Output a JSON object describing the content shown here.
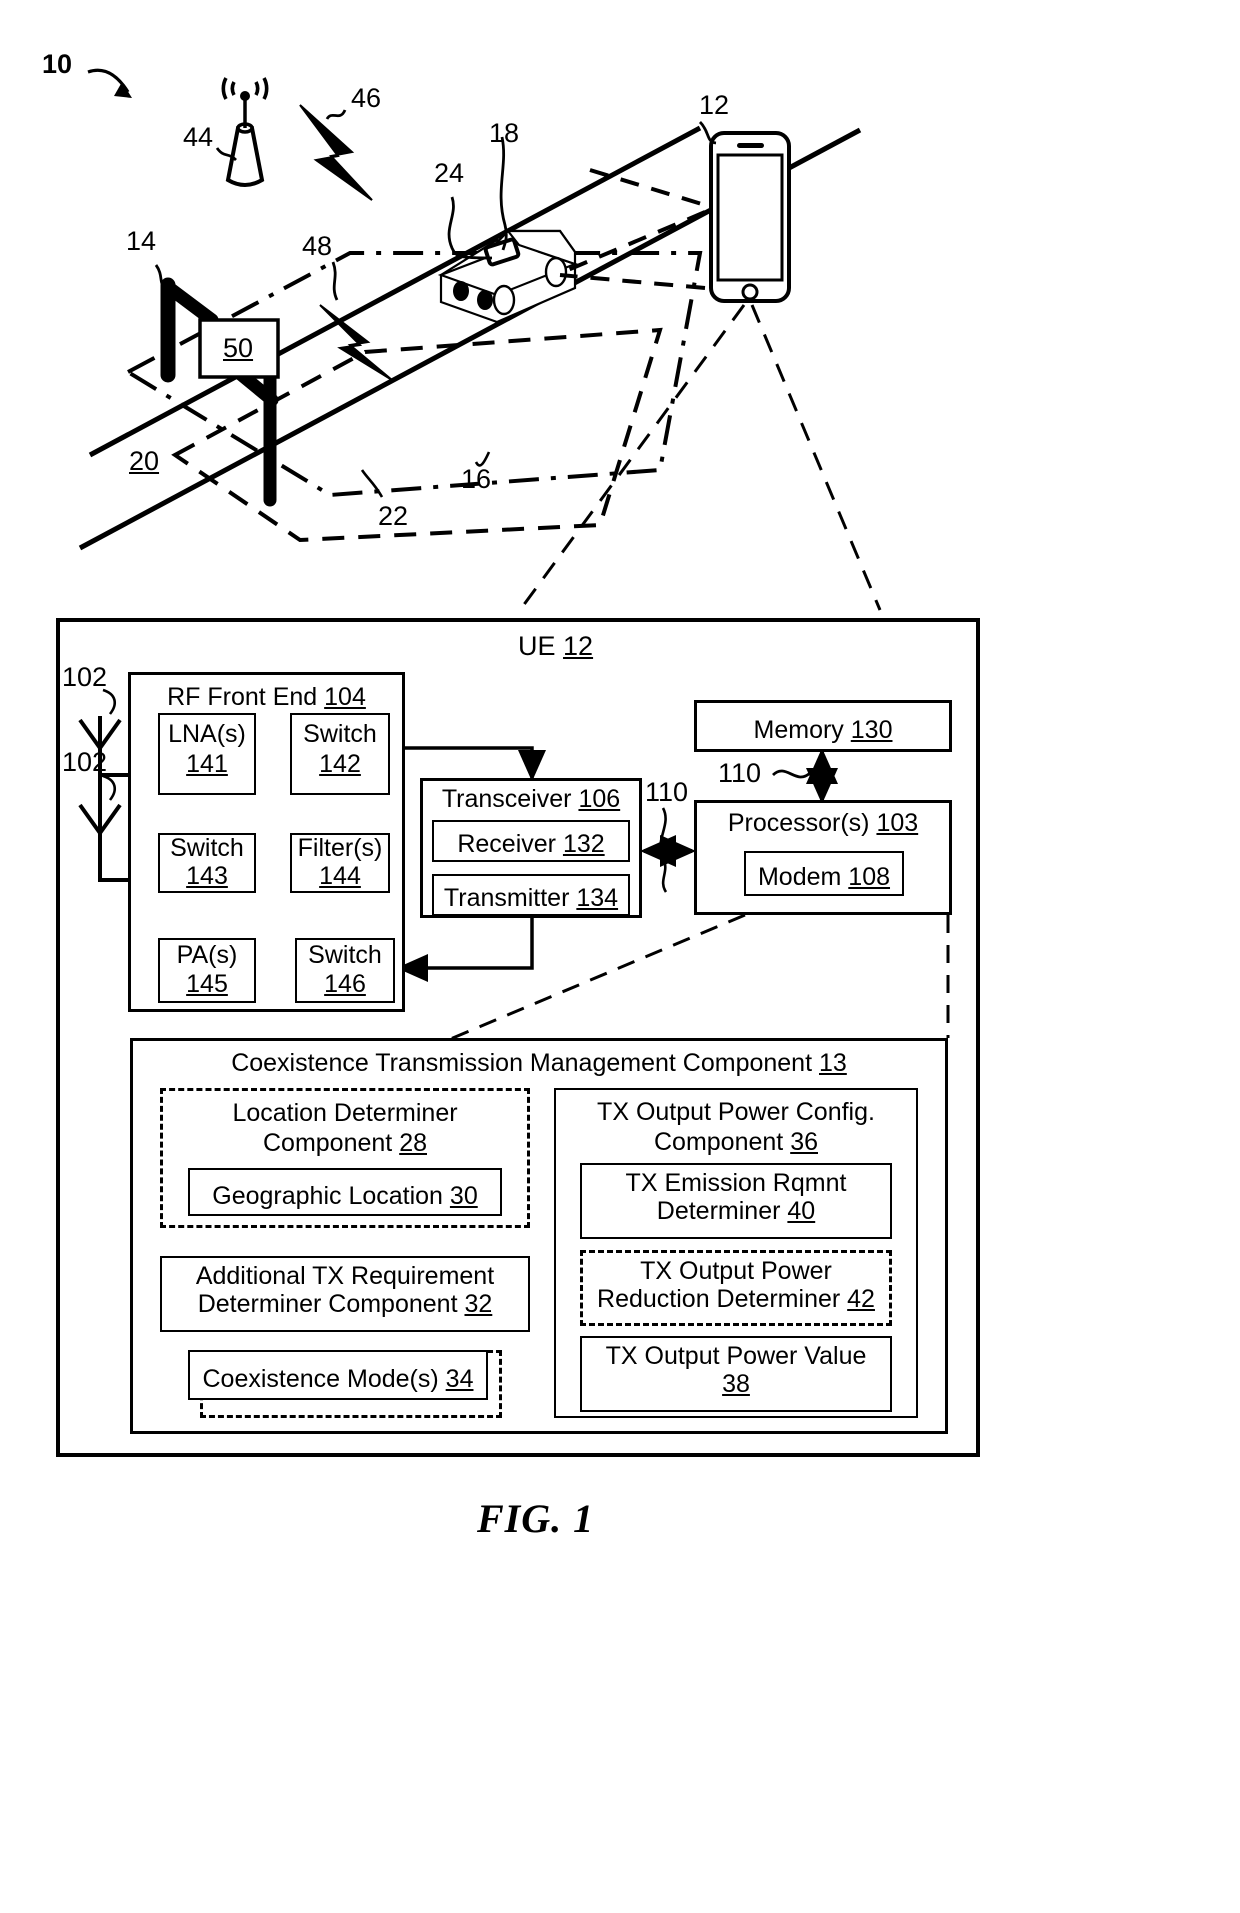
{
  "figure": {
    "caption": "FIG. 1",
    "system_ref": "10"
  },
  "scene": {
    "refs": {
      "system": "10",
      "base_station": "44",
      "base_station_signal": "46",
      "ue": "12",
      "vehicle": "18",
      "vehicle_device": "24",
      "toll_gantry": "14",
      "toll_transceiver": "50",
      "toll_signal": "48",
      "road": "20",
      "geofence_outer": "16",
      "geofence_inner": "22"
    },
    "toll_box_label": "50"
  },
  "ue": {
    "title": "UE",
    "title_ref": "12",
    "antenna_ref_1": "102",
    "antenna_ref_2": "102",
    "rf_front_end": {
      "title": "RF Front End",
      "ref": "104",
      "blocks": [
        {
          "label": "LNA(s)",
          "ref": "141"
        },
        {
          "label": "Switch",
          "ref": "142"
        },
        {
          "label": "Switch",
          "ref": "143"
        },
        {
          "label": "Filter(s)",
          "ref": "144"
        },
        {
          "label": "PA(s)",
          "ref": "145"
        },
        {
          "label": "Switch",
          "ref": "146"
        }
      ]
    },
    "transceiver": {
      "title": "Transceiver",
      "ref": "106",
      "blocks": [
        {
          "label": "Receiver",
          "ref": "132"
        },
        {
          "label": "Transmitter",
          "ref": "134"
        }
      ]
    },
    "bus_ref_left": "110",
    "bus_ref_right": "110",
    "memory": {
      "label": "Memory",
      "ref": "130"
    },
    "processor": {
      "label": "Processor(s)",
      "ref": "103"
    },
    "modem": {
      "label": "Modem",
      "ref": "108"
    },
    "coexistence": {
      "title": "Coexistence Transmission Management Component",
      "ref": "13",
      "location_determiner": {
        "line1": "Location Determiner",
        "line2": "Component",
        "ref": "28"
      },
      "geographic_location": {
        "label": "Geographic Location",
        "ref": "30"
      },
      "additional_tx": {
        "line1": "Additional TX Requirement",
        "line2": "Determiner Component",
        "ref": "32"
      },
      "coexistence_modes": {
        "label": "Coexistence Mode(s)",
        "ref": "34"
      },
      "tx_output_power_config": {
        "line1": "TX Output Power Config.",
        "line2": "Component",
        "ref": "36"
      },
      "tx_emission_rqmnt": {
        "line1": "TX Emission Rqmnt",
        "line2": "Determiner",
        "ref": "40"
      },
      "tx_output_power_reduction": {
        "line1": "TX Output Power",
        "line2": "Reduction Determiner",
        "ref": "42"
      },
      "tx_output_power_value": {
        "line1": "TX Output Power Value",
        "ref": "38"
      }
    }
  }
}
